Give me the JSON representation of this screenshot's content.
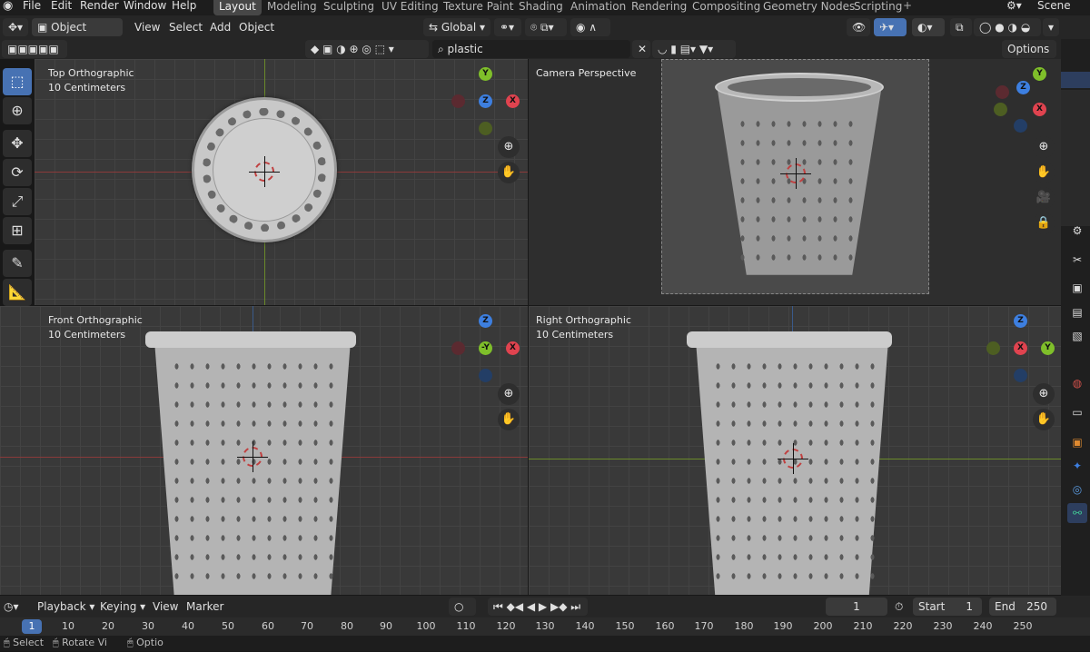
{
  "app": {
    "menu": [
      "File",
      "Edit",
      "Render",
      "Window",
      "Help"
    ],
    "workspaces": [
      "Layout",
      "Modeling",
      "Sculpting",
      "UV Editing",
      "Texture Paint",
      "Shading",
      "Animation",
      "Rendering",
      "Compositing",
      "Geometry Nodes",
      "Scripting"
    ],
    "active_workspace": "Layout",
    "add_workspace": "+",
    "scene": "Scene"
  },
  "header": {
    "mode": "Object Mode",
    "view": "View",
    "select": "Select",
    "add": "Add",
    "object": "Object",
    "orientation": "Global",
    "options": "Options",
    "search_value": "plastic"
  },
  "viewports": [
    {
      "title": "Top Orthographic",
      "scale": "10 Centimeters"
    },
    {
      "title": "Camera Perspective",
      "scale": ""
    },
    {
      "title": "Front Orthographic",
      "scale": "10 Centimeters"
    },
    {
      "title": "Right Orthographic",
      "scale": "10 Centimeters"
    }
  ],
  "gizmo_labels": {
    "x": "X",
    "y": "Y",
    "z": "Z",
    "neg_y": "-Y"
  },
  "timeline": {
    "playback": "Playback",
    "keying": "Keying",
    "view": "View",
    "marker": "Marker",
    "current_frame": "1",
    "start_label": "Start",
    "start": "1",
    "end_label": "End",
    "end": "250",
    "ticks": [
      "1",
      "10",
      "20",
      "30",
      "40",
      "50",
      "60",
      "70",
      "80",
      "90",
      "100",
      "110",
      "120",
      "130",
      "140",
      "150",
      "160",
      "170",
      "180",
      "190",
      "200",
      "210",
      "220",
      "230",
      "240",
      "250"
    ]
  },
  "status": {
    "select": "Select",
    "rotate": "Rotate Vi",
    "options": "Optio"
  },
  "colors": {
    "accent": "#4772b3",
    "x_axis": "#e0434f",
    "y_axis": "#7fbf2a",
    "z_axis": "#3d7fe0"
  }
}
